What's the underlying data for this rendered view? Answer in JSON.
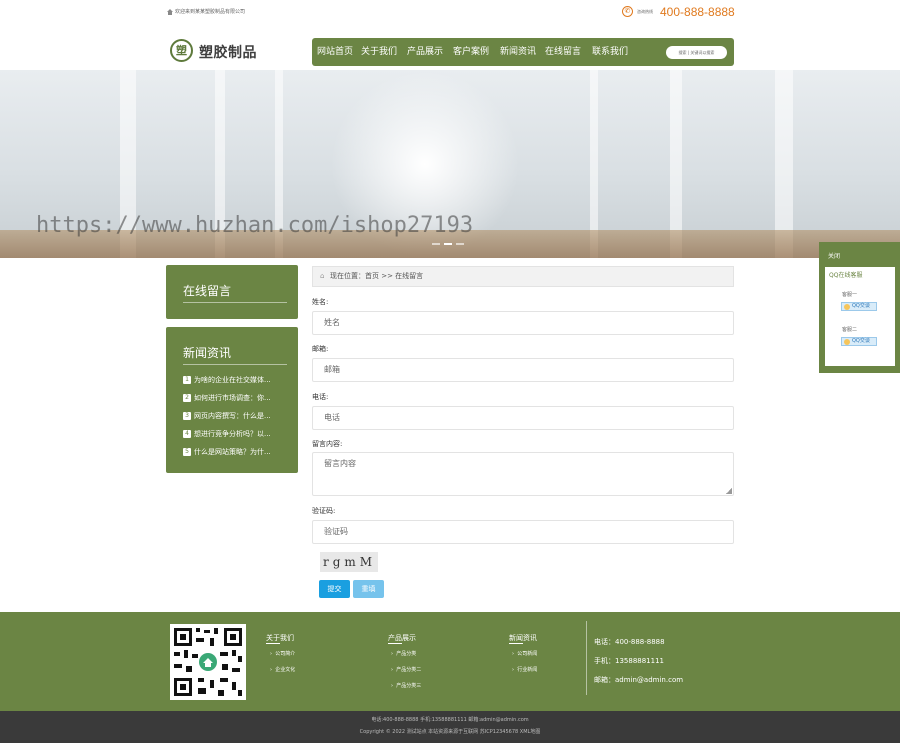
{
  "topbar": {
    "welcome": "欢迎来到某某塑胶制品有限公司",
    "tel_label": "咨询热线",
    "tel": "400-888-8888"
  },
  "logo": {
    "mark": "塑",
    "name": "塑胶制品"
  },
  "nav": {
    "items": [
      "网站首页",
      "关于我们",
      "产品展示",
      "客户案例",
      "新闻资讯",
      "在线留言",
      "联系我们"
    ],
    "search_label": "搜索 | 关键词以搜索"
  },
  "banner": {
    "watermark": "https://www.huzhan.com/ishop27193"
  },
  "sidebar": {
    "message_title": "在线留言",
    "news_title": "新闻资讯",
    "news": [
      {
        "num": "1",
        "text": "为啥的企业在社交媒体..."
      },
      {
        "num": "2",
        "text": "如何进行市场调查：你..."
      },
      {
        "num": "3",
        "text": "网页内容撰写：什么是..."
      },
      {
        "num": "4",
        "text": "想进行竞争分析吗？以..."
      },
      {
        "num": "5",
        "text": "什么是网站策略？为什..."
      }
    ]
  },
  "breadcrumb": {
    "text": "现在位置：首页 >> 在线留言"
  },
  "form": {
    "name_label": "姓名:",
    "name_placeholder": "姓名",
    "email_label": "邮箱:",
    "email_placeholder": "邮箱",
    "phone_label": "电话:",
    "phone_placeholder": "电话",
    "content_label": "留言内容:",
    "content_placeholder": "留言内容",
    "captcha_label": "验证码:",
    "captcha_placeholder": "验证码",
    "captcha_text": "rgmM",
    "submit_label": "提交",
    "reset_label": "重填"
  },
  "float_qq": {
    "head": "关闭",
    "title": "QQ在线客服",
    "agents": [
      {
        "name": "客服一",
        "label": "QQ交谈"
      },
      {
        "name": "客服二",
        "label": "QQ交谈"
      }
    ]
  },
  "footer": {
    "col1_title": "关于我们",
    "col1_links": [
      "公司简介",
      "企业文化"
    ],
    "col2_title": "产品展示",
    "col2_links": [
      "产品分类",
      "产品分类二",
      "产品分类三"
    ],
    "col3_title": "新闻资讯",
    "col3_links": [
      "公司新闻",
      "行业新闻"
    ],
    "phone": "电话：400-888-8888",
    "mobile": "手机：13588881111",
    "email": "邮箱：admin@admin.com"
  },
  "bottom": {
    "line1": "电话:400-888-8888  手机:13588881111  邮箱:admin@admin.com",
    "line2": "Copyright © 2022 测试站点  本站资源来源于互联网  苏ICP12345678  XML地图"
  },
  "colors": {
    "brand_green": "#6b8544",
    "accent_orange": "#e07a1f",
    "footer_dark": "#3a3a3a",
    "button_blue": "#1a9fe0"
  }
}
